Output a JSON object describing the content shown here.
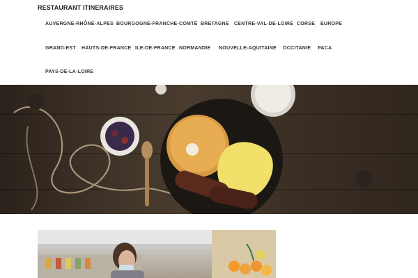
{
  "site": {
    "title": "RESTAURANT ITINERAIRES"
  },
  "nav": {
    "items": [
      "AUVERGNE-RHÔNE-ALPES",
      "BOURGOGNE-FRANCHE-COMTÉ",
      "BRETAGNE",
      "CENTRE-VAL-DE-LOIRE",
      "CORSE",
      "EUROPE",
      "GRAND-EST",
      "HAUTS-DE-FRANCE",
      "ILE-DE-FRANCE",
      "NORMANDIE",
      "NOUVELLE-AQUITAINE",
      "OCCITANIE",
      "PACA",
      "PAYS-DE-LA-LOIRE"
    ]
  },
  "colors": {
    "nav_text": "#333333",
    "hero_wood": "#3d3127",
    "header_bg": "#ffffff"
  },
  "icons": {
    "hero": "breakfast-table-photo",
    "card": "grocery-shopper-photo"
  }
}
